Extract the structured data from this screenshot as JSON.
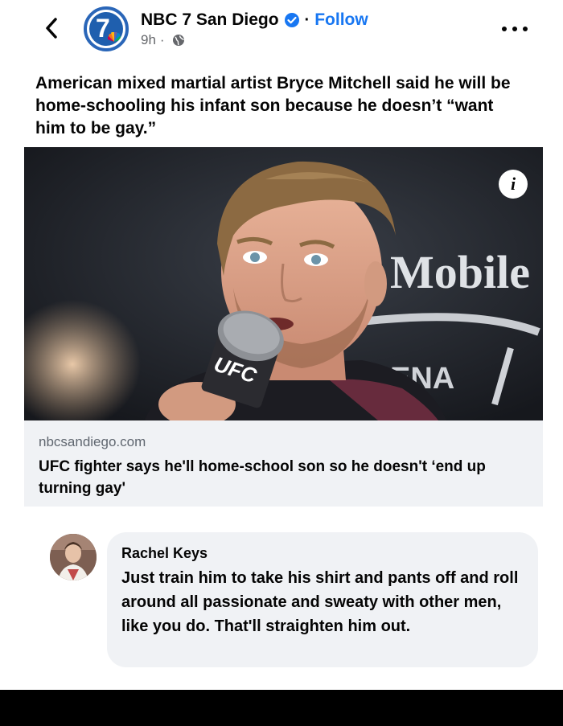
{
  "header": {
    "back_icon": "chevron-left-icon",
    "page_name": "NBC 7 San Diego",
    "verified_icon": "verified-badge-icon",
    "separator": "·",
    "follow_label": "Follow",
    "time": "9h",
    "meta_separator": "·",
    "audience_icon": "globe-icon",
    "more_icon": "more-horizontal-icon",
    "avatar_text": "7",
    "accent_color": "#1877f2"
  },
  "post": {
    "text": "American mixed martial artist Bryce Mitchell said he will be home-schooling his infant son because he doesn’t “want him to be gay.”"
  },
  "link_card": {
    "info_label": "i",
    "image_texts": {
      "mic_logo": "UFC",
      "background_sign": "Mobile",
      "background_arena": "ENA"
    },
    "domain": "nbcsandiego.com",
    "title": "UFC fighter says he'll home-school son so he doesn't ‘end up turning gay'"
  },
  "comment": {
    "author": "Rachel Keys",
    "text": "Just train him to take his shirt and pants off and roll around all passionate and sweaty with other men, like you do.  That'll straighten him out."
  }
}
